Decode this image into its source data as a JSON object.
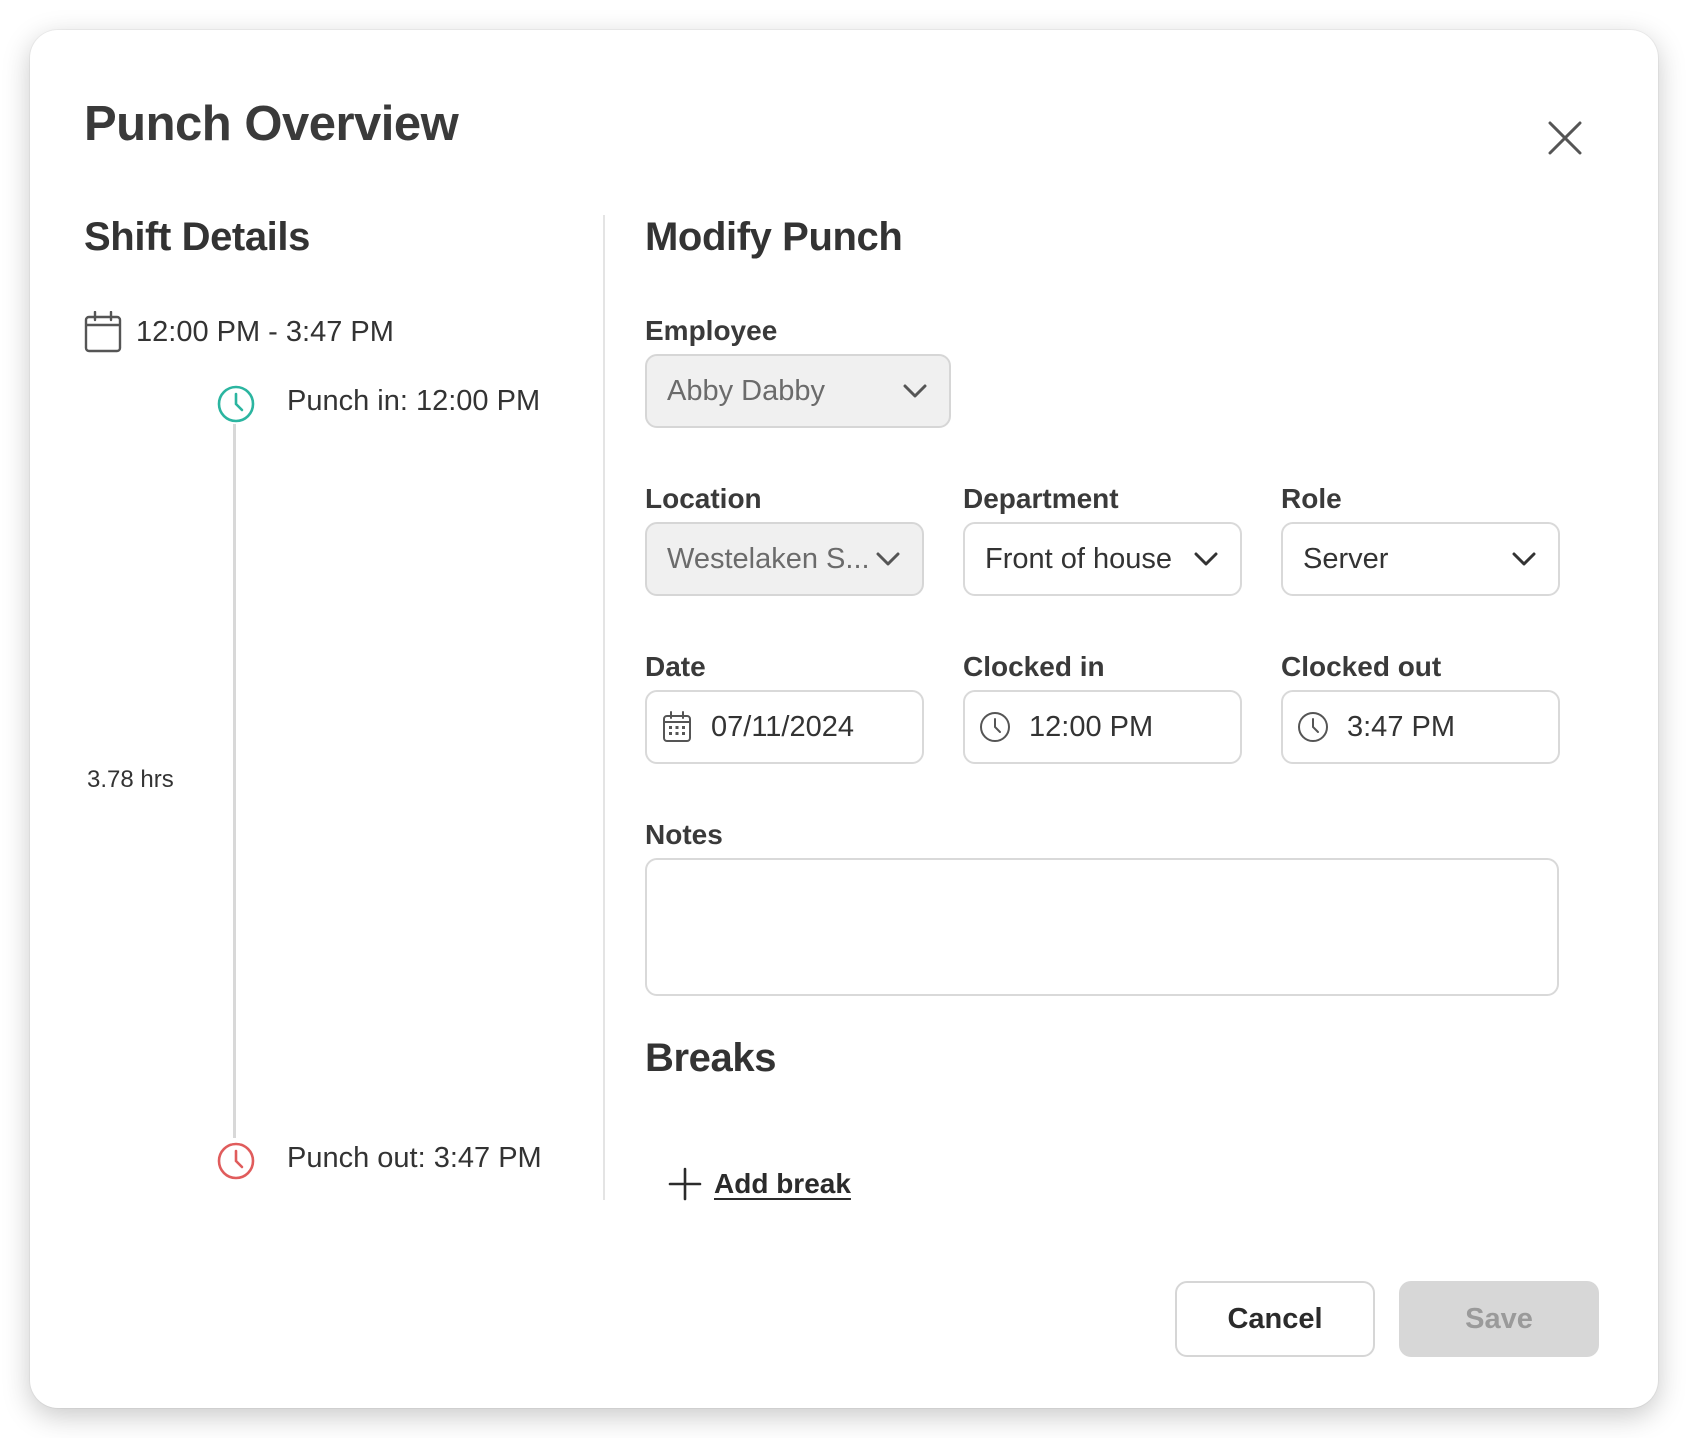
{
  "modal": {
    "title": "Punch Overview",
    "close_icon": "close-icon"
  },
  "shift_details": {
    "title": "Shift Details",
    "range": "12:00 PM - 3:47 PM",
    "punch_in": "Punch in: 12:00 PM",
    "punch_out": "Punch out: 3:47 PM",
    "duration": "3.78 hrs",
    "punch_in_color": "#2bb5a0",
    "punch_out_color": "#e05c5c"
  },
  "modify_punch": {
    "title": "Modify Punch",
    "employee": {
      "label": "Employee",
      "value": "Abby Dabby"
    },
    "location": {
      "label": "Location",
      "value": "Westelaken S..."
    },
    "department": {
      "label": "Department",
      "value": "Front of house"
    },
    "role": {
      "label": "Role",
      "value": "Server"
    },
    "date": {
      "label": "Date",
      "value": "07/11/2024"
    },
    "clocked_in": {
      "label": "Clocked in",
      "value": "12:00 PM"
    },
    "clocked_out": {
      "label": "Clocked out",
      "value": "3:47 PM"
    },
    "notes": {
      "label": "Notes",
      "value": ""
    }
  },
  "breaks": {
    "title": "Breaks",
    "add_label": "Add break"
  },
  "footer": {
    "cancel_label": "Cancel",
    "save_label": "Save"
  }
}
